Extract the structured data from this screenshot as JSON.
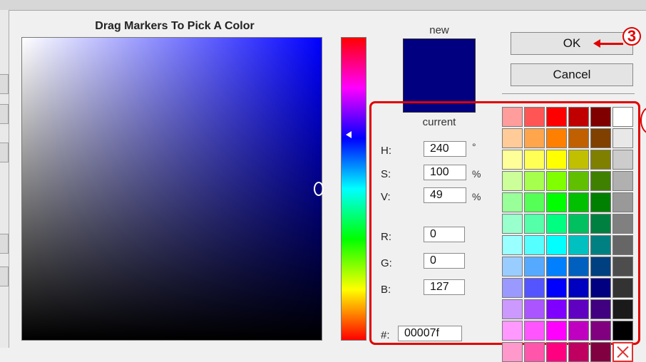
{
  "picker": {
    "title": "Drag Markers To Pick A Color",
    "new_label": "new",
    "current_label": "current",
    "new_color": "#000080",
    "hue_gradient": [
      "#ff0000",
      "#ff00ff",
      "#0000ff",
      "#00ffff",
      "#00ff00",
      "#ffff00",
      "#ff0000"
    ]
  },
  "buttons": {
    "ok": "OK",
    "cancel": "Cancel"
  },
  "annotations": {
    "step_ok": "3",
    "color": "#e00000"
  },
  "fields": {
    "h": {
      "label": "H:",
      "value": "240",
      "unit": "°"
    },
    "s": {
      "label": "S:",
      "value": "100",
      "unit": "%"
    },
    "v": {
      "label": "V:",
      "value": "49",
      "unit": "%"
    },
    "r": {
      "label": "R:",
      "value": "0"
    },
    "g": {
      "label": "G:",
      "value": "0"
    },
    "b": {
      "label": "B:",
      "value": "127"
    },
    "hex": {
      "label": "#:",
      "value": "00007f"
    }
  },
  "swatches": [
    [
      "#ff9c9c",
      "#ff5555",
      "#ff0000",
      "#c00000",
      "#800000",
      "#ffffff"
    ],
    [
      "#ffcc99",
      "#ffa64d",
      "#ff8000",
      "#c06000",
      "#804000",
      "#e8e8e8"
    ],
    [
      "#ffff99",
      "#ffff55",
      "#ffff00",
      "#c0c000",
      "#808000",
      "#cccccc"
    ],
    [
      "#ccff99",
      "#a6ff4d",
      "#80ff00",
      "#60c000",
      "#408000",
      "#b0b0b0"
    ],
    [
      "#99ff99",
      "#55ff55",
      "#00ff00",
      "#00c000",
      "#008000",
      "#999999"
    ],
    [
      "#99ffcc",
      "#55ffaa",
      "#00ff80",
      "#00c060",
      "#008040",
      "#808080"
    ],
    [
      "#99ffff",
      "#55ffff",
      "#00ffff",
      "#00c0c0",
      "#008080",
      "#666666"
    ],
    [
      "#99ccff",
      "#55aaff",
      "#0080ff",
      "#0060c0",
      "#004080",
      "#4d4d4d"
    ],
    [
      "#9999ff",
      "#5555ff",
      "#0000ff",
      "#0000c0",
      "#000080",
      "#333333"
    ],
    [
      "#cc99ff",
      "#aa55ff",
      "#8000ff",
      "#6000c0",
      "#400080",
      "#1a1a1a"
    ],
    [
      "#ff99ff",
      "#ff55ff",
      "#ff00ff",
      "#c000c0",
      "#800080",
      "#000000"
    ],
    [
      "#ff99cc",
      "#ff55aa",
      "#ff0080",
      "#c00060",
      "#800040",
      "no-color-icon"
    ]
  ]
}
